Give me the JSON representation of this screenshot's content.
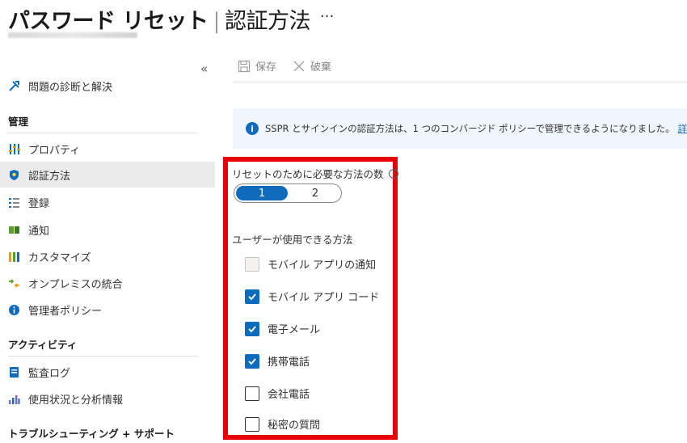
{
  "header": {
    "title": "パスワード リセット",
    "separator": "|",
    "subtitle": "認証方法",
    "more": "···"
  },
  "sidebar": {
    "collapse": "«",
    "diagnose": "問題の診断と解決",
    "section_manage": "管理",
    "items_manage": [
      {
        "label": "プロパティ",
        "icon": "properties-icon"
      },
      {
        "label": "認証方法",
        "icon": "shield-icon"
      },
      {
        "label": "登録",
        "icon": "registration-icon"
      },
      {
        "label": "通知",
        "icon": "notification-icon"
      },
      {
        "label": "カスタマイズ",
        "icon": "customize-icon"
      },
      {
        "label": "オンプレミスの統合",
        "icon": "integration-icon"
      },
      {
        "label": "管理者ポリシー",
        "icon": "info-icon"
      }
    ],
    "section_activity": "アクティビティ",
    "items_activity": [
      {
        "label": "監査ログ",
        "icon": "audit-log-icon"
      },
      {
        "label": "使用状況と分析情報",
        "icon": "analytics-icon"
      }
    ],
    "section_support": "トラブルシューティング + サポート"
  },
  "toolbar": {
    "save_label": "保存",
    "discard_label": "破棄"
  },
  "banner": {
    "icon": "i",
    "text": "SSPR とサインインの認証方法は、1 つのコンバージド ポリシーで管理できるようになりました。",
    "link": "詳細情報"
  },
  "form": {
    "required_label": "リセットのために必要な方法の数",
    "info_glyph": "i",
    "toggle_options": [
      "1",
      "2"
    ],
    "toggle_selected": "1",
    "methods_label": "ユーザーが使用できる方法",
    "methods": [
      {
        "label": "モバイル アプリの通知",
        "checked": false,
        "disabled": true
      },
      {
        "label": "モバイル アプリ コード",
        "checked": true,
        "disabled": false
      },
      {
        "label": "電子メール",
        "checked": true,
        "disabled": false
      },
      {
        "label": "携帯電話",
        "checked": true,
        "disabled": false
      },
      {
        "label": "会社電話",
        "checked": false,
        "disabled": false
      },
      {
        "label": "秘密の質問",
        "checked": false,
        "disabled": false
      }
    ]
  },
  "colors": {
    "accent": "#0f6cbd",
    "highlight": "#e8000b",
    "banner_bg": "#f0f6fd",
    "active_bg": "#ebebeb"
  }
}
